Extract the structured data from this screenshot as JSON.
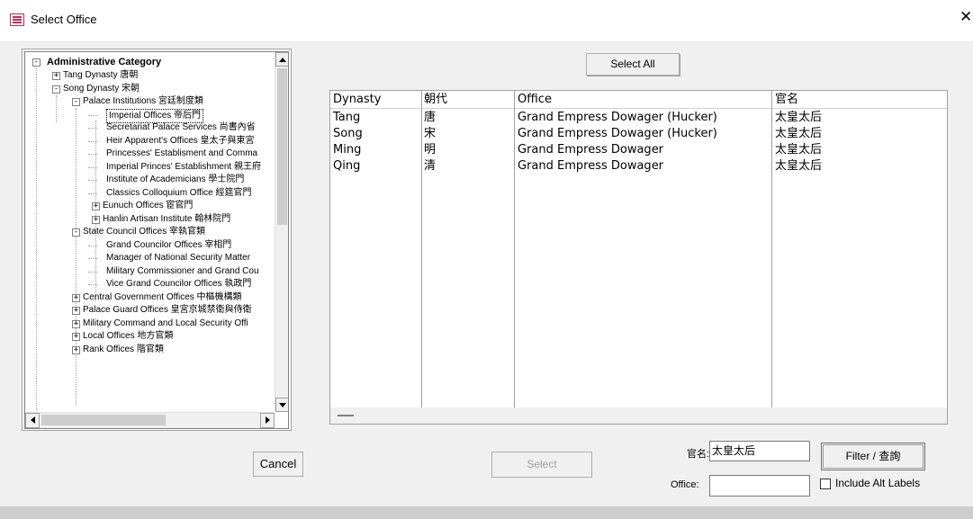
{
  "window": {
    "title": "Select Office",
    "close_glyph": "✕"
  },
  "tree": {
    "root": "Administrative Category",
    "nodes": [
      {
        "label": "Tang Dynasty 唐朝",
        "exp": "+"
      },
      {
        "label": "Song Dynasty 宋朝",
        "exp": "-"
      },
      {
        "label": "Palace Institutions 宮廷制度類",
        "exp": "-"
      },
      {
        "label": "Imperial Offices 帝后門"
      },
      {
        "label": "Secretariat Palace Services 尚書內省"
      },
      {
        "label": "Heir Apparent's Offices 皇太子與東宮"
      },
      {
        "label": "Princesses' Establisment and Comma"
      },
      {
        "label": "Imperial Princes' Establishment 親王府"
      },
      {
        "label": "Institute of Academicians 學士院門"
      },
      {
        "label": "Classics Colloquium Office 經筵官門"
      },
      {
        "label": "Eunuch Offices 宦官門",
        "exp": "+"
      },
      {
        "label": "Hanlin Artisan Institute 翰林院門",
        "exp": "+"
      },
      {
        "label": "State Council Offices 宰執官類",
        "exp": "-"
      },
      {
        "label": "Grand Councilor Offices 宰相門"
      },
      {
        "label": "Manager of National Security Matter"
      },
      {
        "label": "Military Commissioner and Grand Cou"
      },
      {
        "label": "Vice Grand Councilor Offices 執政門"
      },
      {
        "label": "Central Government Offices 中樞機構類",
        "exp": "+"
      },
      {
        "label": "Palace Guard Offices 皇宮京城禁衛與侍衛",
        "exp": "+"
      },
      {
        "label": "Military Command and Local Security Offi",
        "exp": "+"
      },
      {
        "label": "Local Offices 地方官類",
        "exp": "+"
      },
      {
        "label": "Rank Offices 階官類",
        "exp": "+"
      }
    ]
  },
  "buttons": {
    "select_all": "Select All",
    "cancel": "Cancel",
    "select": "Select",
    "filter": "Filter / 查詢"
  },
  "list": {
    "columns": [
      "Dynasty",
      "朝代",
      "Office",
      "官名"
    ],
    "rows": [
      [
        "Tang",
        "唐",
        "Grand Empress Dowager (Hucker)",
        "太皇太后"
      ],
      [
        "Song",
        "宋",
        "Grand Empress Dowager (Hucker)",
        "太皇太后"
      ],
      [
        "Ming",
        "明",
        "Grand Empress Dowager",
        "太皇太后"
      ],
      [
        "Qing",
        "清",
        "Grand Empress Dowager",
        "太皇太后"
      ]
    ]
  },
  "form": {
    "guanming_label": "官名:",
    "guanming_value": "太皇太后",
    "office_label": "Office:",
    "office_value": "",
    "include_alt_label": "Include Alt Labels",
    "include_alt_checked": false
  }
}
